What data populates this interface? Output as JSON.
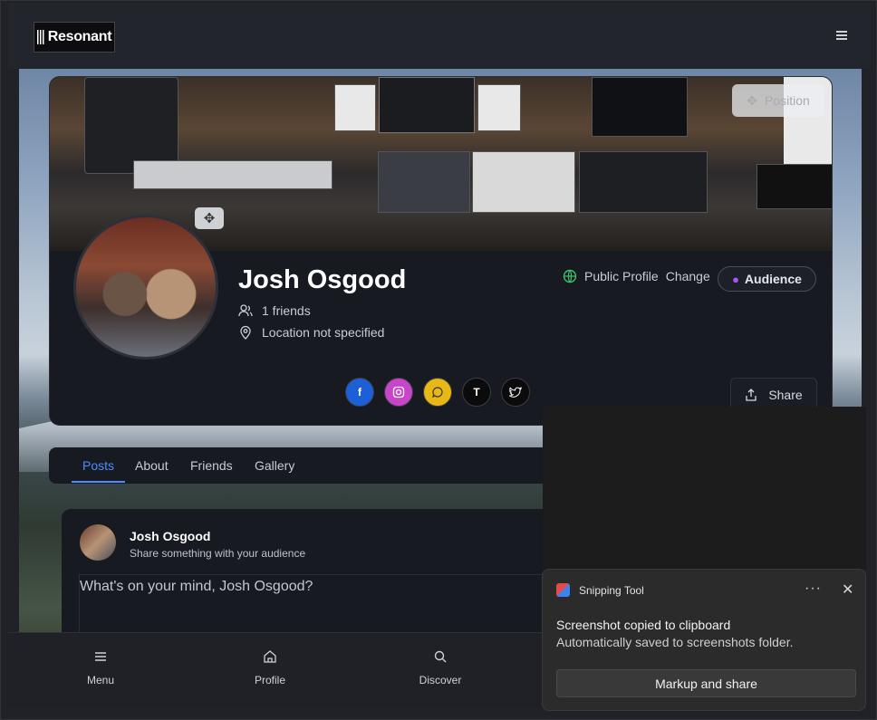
{
  "header": {
    "logo_text": "Resonant",
    "menu_icon": "hamburger-icon"
  },
  "cover": {
    "position_label": "Position",
    "move_icon": "move-icon"
  },
  "profile": {
    "name": "Josh Osgood",
    "friends": "1 friends",
    "location": "Location not specified",
    "visibility_label": "Public Profile",
    "change_label": "Change",
    "audience_label": "Audience",
    "share_label": "Share",
    "socials": [
      {
        "name": "facebook",
        "glyph": "f",
        "color": "#1d5fd6"
      },
      {
        "name": "instagram",
        "glyph": "",
        "color": "#c844c8"
      },
      {
        "name": "chat",
        "glyph": "",
        "color": "#e8b816"
      },
      {
        "name": "t",
        "glyph": "T",
        "color": "#0b0b0b"
      },
      {
        "name": "twitter",
        "glyph": "",
        "color": "#0b0b0b"
      }
    ]
  },
  "tabs": [
    {
      "label": "Posts",
      "active": true
    },
    {
      "label": "About",
      "active": false
    },
    {
      "label": "Friends",
      "active": false
    },
    {
      "label": "Gallery",
      "active": false
    }
  ],
  "composer": {
    "name": "Josh Osgood",
    "subtitle": "Share something with your audience",
    "placeholder": "What's on your mind, Josh Osgood?"
  },
  "bottom_nav": [
    {
      "label": "Menu",
      "icon": "menu-icon"
    },
    {
      "label": "Profile",
      "icon": "home-icon"
    },
    {
      "label": "Discover",
      "icon": "search-icon"
    }
  ],
  "toast": {
    "app_name": "Snipping Tool",
    "title": "Screenshot copied to clipboard",
    "body": "Automatically saved to screenshots folder.",
    "button_label": "Markup and share",
    "more_label": "···",
    "close_label": "✕"
  },
  "colors": {
    "accent": "#4c8dff",
    "card_bg": "#171a21",
    "visibility_green": "#3fbf6a"
  }
}
